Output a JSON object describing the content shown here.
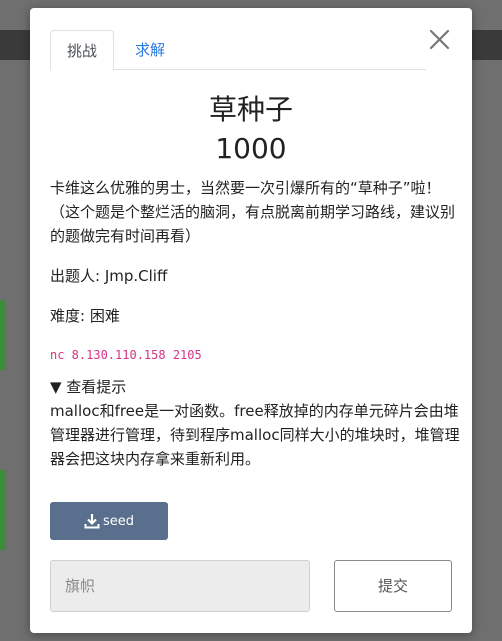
{
  "tabs": {
    "challenge": "挑战",
    "solves": "求解"
  },
  "challenge": {
    "name": "草种子",
    "value": "1000",
    "description": "卡维这么优雅的男士，当然要一次引爆所有的“草种子”啦！（这个题是个整烂活的脑洞，有点脱离前期学习路线，建议别的题做完有时间再看）",
    "author": "出题人: Jmp.Cliff",
    "difficulty": "难度: 困难",
    "connection": "nc 8.130.110.158 2105",
    "hint_toggle": "▼ 查看提示",
    "hint_text": "malloc和free是一对函数。free释放掉的内存单元碎片会由堆管理器进行管理，待到程序malloc同样大小的堆块时，堆管理器会把这块内存拿来重新利用。"
  },
  "files": {
    "seed_label": "seed"
  },
  "submit": {
    "placeholder": "旗帜",
    "button_label": "提交"
  },
  "colors": {
    "link": "#2a7ae2",
    "seed_button": "#5a6f8e",
    "code": "#d63384"
  },
  "icons": {
    "close": "close-icon",
    "download": "download-icon"
  }
}
